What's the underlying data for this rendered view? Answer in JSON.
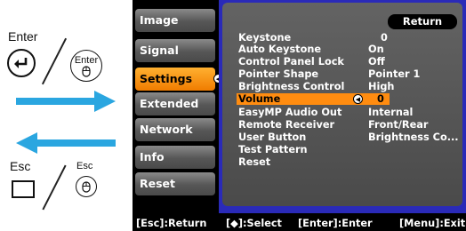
{
  "legend": {
    "enter_label": "Enter",
    "remote_enter_label": "Enter",
    "esc_label": "Esc",
    "remote_esc_label": "Esc",
    "arrow_color": "#2aa6e0"
  },
  "sidebar": {
    "items": [
      {
        "label": "Image"
      },
      {
        "label": "Signal"
      },
      {
        "label": "Settings",
        "active": true
      },
      {
        "label": "Extended"
      },
      {
        "label": "Network"
      },
      {
        "label": "Info"
      },
      {
        "label": "Reset"
      }
    ]
  },
  "panel": {
    "return_label": "Return",
    "rows": [
      {
        "name": "Keystone",
        "value": "0"
      },
      {
        "name": "Auto Keystone",
        "value": "On"
      },
      {
        "name": "Control Panel Lock",
        "value": "Off"
      },
      {
        "name": "Pointer Shape",
        "value": "Pointer 1"
      },
      {
        "name": "Brightness Control",
        "value": "High"
      },
      {
        "name": "Volume",
        "value": "0",
        "selected": true
      },
      {
        "name": "EasyMP Audio Out",
        "value": "Internal"
      },
      {
        "name": "Remote Receiver",
        "value": "Front/Rear"
      },
      {
        "name": "User Button",
        "value": "Brightness Co..."
      },
      {
        "name": "Test Pattern",
        "value": ""
      },
      {
        "name": "Reset",
        "value": ""
      }
    ]
  },
  "footer": {
    "esc_hint": "[Esc]:Return",
    "select_hint": "[◆]:Select",
    "enter_hint": "[Enter]:Enter",
    "menu_hint": "[Menu]:Exit"
  },
  "colors": {
    "active_tab": "#f08a00",
    "selected_row": "#ff8c10",
    "panel_frame": "#2a2ab8"
  }
}
